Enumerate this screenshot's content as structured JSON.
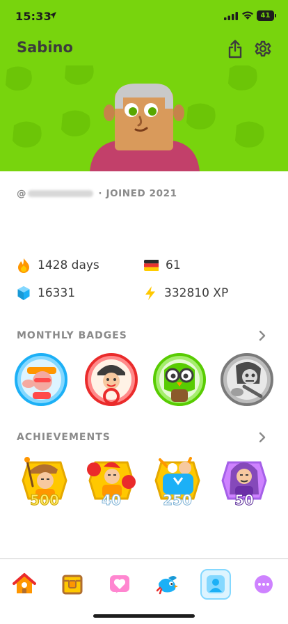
{
  "status_bar": {
    "time": "15:33",
    "battery": "41"
  },
  "header": {
    "username": "Sabino"
  },
  "profile": {
    "at_sign": "@",
    "joined": "· JOINED 2021"
  },
  "stats": {
    "streak": "1428 days",
    "course_level": "61",
    "gems": "16331",
    "xp": "332810 XP"
  },
  "monthly_badges": {
    "title": "MONTHLY BADGES"
  },
  "achievements": {
    "title": "ACHIEVEMENTS",
    "items": [
      {
        "value": "500"
      },
      {
        "value": "40"
      },
      {
        "value": "250"
      },
      {
        "value": "50"
      }
    ]
  },
  "icons": [
    "location-arrow-icon",
    "signal-icon",
    "wifi-icon",
    "share-icon",
    "gear-icon",
    "fire-icon",
    "german-flag-icon",
    "gem-icon",
    "lightning-icon",
    "chevron-right-icon",
    "home-icon",
    "chest-icon",
    "heart-icon",
    "bird-icon",
    "profile-icon",
    "more-icon"
  ],
  "colors": {
    "hero_green": "#78d40d",
    "streak_orange": "#ff9600",
    "gem_blue": "#1cb0f6",
    "xp_yellow": "#ffc800",
    "active_tab_bg": "#ddf4ff",
    "active_tab_border": "#84d8ff"
  }
}
